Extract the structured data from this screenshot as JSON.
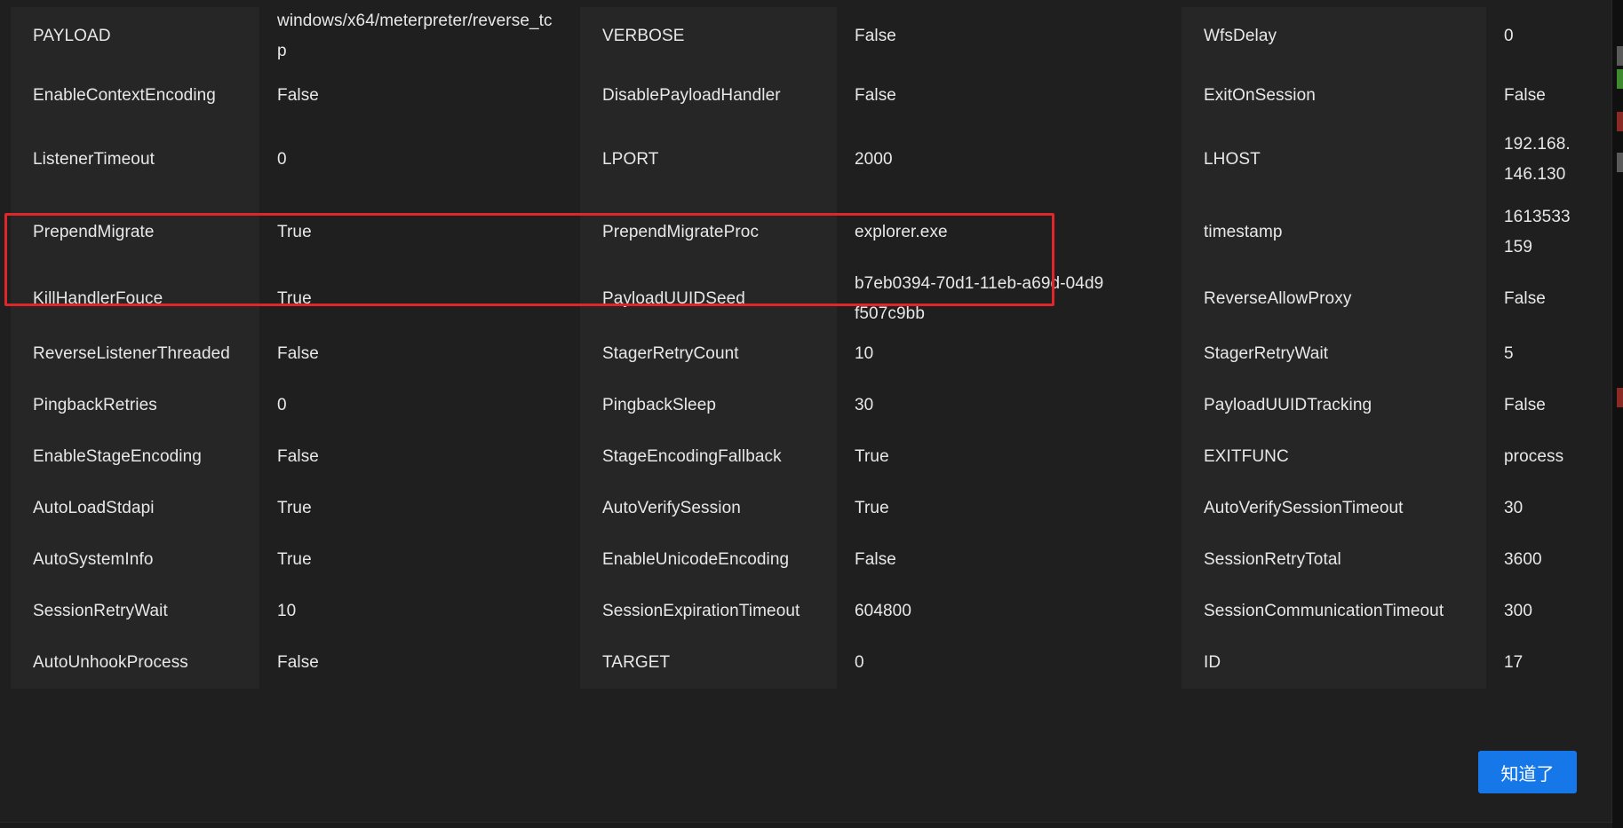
{
  "rows": [
    [
      {
        "label": "PAYLOAD",
        "value": "windows/x64/meterpreter/reverse_tcp"
      },
      {
        "label": "VERBOSE",
        "value": "False"
      },
      {
        "label": "WfsDelay",
        "value": "0"
      }
    ],
    [
      {
        "label": "EnableContextEncoding",
        "value": "False"
      },
      {
        "label": "DisablePayloadHandler",
        "value": "False"
      },
      {
        "label": "ExitOnSession",
        "value": "False"
      }
    ],
    [
      {
        "label": "ListenerTimeout",
        "value": "0"
      },
      {
        "label": "LPORT",
        "value": "2000"
      },
      {
        "label": "LHOST",
        "value": "192.168.146.130"
      }
    ],
    [
      {
        "label": "PrependMigrate",
        "value": "True"
      },
      {
        "label": "PrependMigrateProc",
        "value": "explorer.exe"
      },
      {
        "label": "timestamp",
        "value": "1613533159"
      }
    ],
    [
      {
        "label": "KillHandlerFouce",
        "value": "True"
      },
      {
        "label": "PayloadUUIDSeed",
        "value": "b7eb0394-70d1-11eb-a69d-04d9f507c9bb"
      },
      {
        "label": "ReverseAllowProxy",
        "value": "False"
      }
    ],
    [
      {
        "label": "ReverseListenerThreaded",
        "value": "False"
      },
      {
        "label": "StagerRetryCount",
        "value": "10"
      },
      {
        "label": "StagerRetryWait",
        "value": "5"
      }
    ],
    [
      {
        "label": "PingbackRetries",
        "value": "0"
      },
      {
        "label": "PingbackSleep",
        "value": "30"
      },
      {
        "label": "PayloadUUIDTracking",
        "value": "False"
      }
    ],
    [
      {
        "label": "EnableStageEncoding",
        "value": "False"
      },
      {
        "label": "StageEncodingFallback",
        "value": "True"
      },
      {
        "label": "EXITFUNC",
        "value": "process"
      }
    ],
    [
      {
        "label": "AutoLoadStdapi",
        "value": "True"
      },
      {
        "label": "AutoVerifySession",
        "value": "True"
      },
      {
        "label": "AutoVerifySessionTimeout",
        "value": "30"
      }
    ],
    [
      {
        "label": "AutoSystemInfo",
        "value": "True"
      },
      {
        "label": "EnableUnicodeEncoding",
        "value": "False"
      },
      {
        "label": "SessionRetryTotal",
        "value": "3600"
      }
    ],
    [
      {
        "label": "SessionRetryWait",
        "value": "10"
      },
      {
        "label": "SessionExpirationTimeout",
        "value": "604800"
      },
      {
        "label": "SessionCommunicationTimeout",
        "value": "300"
      }
    ],
    [
      {
        "label": "AutoUnhookProcess",
        "value": "False"
      },
      {
        "label": "TARGET",
        "value": "0"
      },
      {
        "label": "ID",
        "value": "17"
      }
    ]
  ],
  "footer": {
    "ok_label": "知道了"
  },
  "colors": {
    "highlight_border": "#e0262b",
    "primary_button": "#1678e8"
  }
}
